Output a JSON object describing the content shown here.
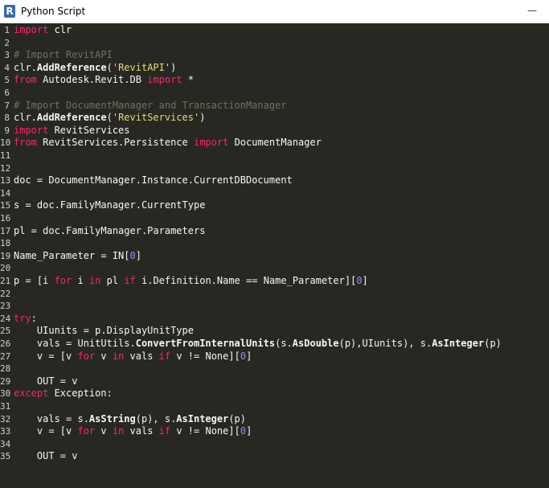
{
  "window": {
    "title": "Python Script",
    "app_icon_letter": "R",
    "minimize_glyph": "—"
  },
  "editor": {
    "lines": [
      {
        "n": "1",
        "tokens": [
          {
            "t": "import",
            "c": "kw"
          },
          {
            "t": " clr",
            "c": "id"
          }
        ]
      },
      {
        "n": "2",
        "tokens": []
      },
      {
        "n": "3",
        "tokens": [
          {
            "t": "# Import RevitAPI",
            "c": "com"
          }
        ]
      },
      {
        "n": "4",
        "tokens": [
          {
            "t": "clr.",
            "c": "id"
          },
          {
            "t": "AddReference",
            "c": "fn"
          },
          {
            "t": "(",
            "c": "id"
          },
          {
            "t": "'RevitAPI'",
            "c": "str"
          },
          {
            "t": ")",
            "c": "id"
          }
        ]
      },
      {
        "n": "5",
        "tokens": [
          {
            "t": "from",
            "c": "kw"
          },
          {
            "t": " Autodesk.Revit.DB ",
            "c": "id"
          },
          {
            "t": "import",
            "c": "kw"
          },
          {
            "t": " *",
            "c": "id"
          }
        ]
      },
      {
        "n": "6",
        "tokens": []
      },
      {
        "n": "7",
        "tokens": [
          {
            "t": "# Import DocumentManager and TransactionManager",
            "c": "com"
          }
        ]
      },
      {
        "n": "8",
        "tokens": [
          {
            "t": "clr.",
            "c": "id"
          },
          {
            "t": "AddReference",
            "c": "fn"
          },
          {
            "t": "(",
            "c": "id"
          },
          {
            "t": "'RevitServices'",
            "c": "str"
          },
          {
            "t": ")",
            "c": "id"
          }
        ]
      },
      {
        "n": "9",
        "tokens": [
          {
            "t": "import",
            "c": "kw"
          },
          {
            "t": " RevitServices",
            "c": "id"
          }
        ]
      },
      {
        "n": "10",
        "tokens": [
          {
            "t": "from",
            "c": "kw"
          },
          {
            "t": " RevitServices.Persistence ",
            "c": "id"
          },
          {
            "t": "import",
            "c": "kw"
          },
          {
            "t": " DocumentManager",
            "c": "id"
          }
        ]
      },
      {
        "n": "11",
        "tokens": []
      },
      {
        "n": "12",
        "tokens": []
      },
      {
        "n": "13",
        "tokens": [
          {
            "t": "doc = DocumentManager.Instance.CurrentDBDocument",
            "c": "id"
          }
        ]
      },
      {
        "n": "14",
        "tokens": []
      },
      {
        "n": "15",
        "tokens": [
          {
            "t": "s = doc.FamilyManager.CurrentType",
            "c": "id"
          }
        ]
      },
      {
        "n": "16",
        "tokens": []
      },
      {
        "n": "17",
        "tokens": [
          {
            "t": "pl = doc.FamilyManager.Parameters",
            "c": "id"
          }
        ]
      },
      {
        "n": "18",
        "tokens": []
      },
      {
        "n": "19",
        "tokens": [
          {
            "t": "Name_Parameter = IN[",
            "c": "id"
          },
          {
            "t": "0",
            "c": "num"
          },
          {
            "t": "]",
            "c": "id"
          }
        ]
      },
      {
        "n": "20",
        "tokens": []
      },
      {
        "n": "21",
        "tokens": [
          {
            "t": "p = [i ",
            "c": "id"
          },
          {
            "t": "for",
            "c": "kw"
          },
          {
            "t": " i ",
            "c": "id"
          },
          {
            "t": "in",
            "c": "kw"
          },
          {
            "t": " pl ",
            "c": "id"
          },
          {
            "t": "if",
            "c": "kw"
          },
          {
            "t": " i.Definition.Name == Name_Parameter][",
            "c": "id"
          },
          {
            "t": "0",
            "c": "num"
          },
          {
            "t": "]",
            "c": "id"
          }
        ]
      },
      {
        "n": "22",
        "tokens": []
      },
      {
        "n": "23",
        "tokens": []
      },
      {
        "n": "24",
        "tokens": [
          {
            "t": "try",
            "c": "kw"
          },
          {
            "t": ":",
            "c": "id"
          }
        ]
      },
      {
        "n": "25",
        "tokens": [
          {
            "t": "    UIunits = p.DisplayUnitType",
            "c": "id"
          }
        ]
      },
      {
        "n": "26",
        "tokens": [
          {
            "t": "    vals = UnitUtils.",
            "c": "id"
          },
          {
            "t": "ConvertFromInternalUnits",
            "c": "fn"
          },
          {
            "t": "(s.",
            "c": "id"
          },
          {
            "t": "AsDouble",
            "c": "fn"
          },
          {
            "t": "(p),UIunits), s.",
            "c": "id"
          },
          {
            "t": "AsInteger",
            "c": "fn"
          },
          {
            "t": "(p)",
            "c": "id"
          }
        ]
      },
      {
        "n": "27",
        "tokens": [
          {
            "t": "    v = [v ",
            "c": "id"
          },
          {
            "t": "for",
            "c": "kw"
          },
          {
            "t": " v ",
            "c": "id"
          },
          {
            "t": "in",
            "c": "kw"
          },
          {
            "t": " vals ",
            "c": "id"
          },
          {
            "t": "if",
            "c": "kw"
          },
          {
            "t": " v != None][",
            "c": "id"
          },
          {
            "t": "0",
            "c": "num"
          },
          {
            "t": "]",
            "c": "id"
          }
        ]
      },
      {
        "n": "28",
        "tokens": []
      },
      {
        "n": "29",
        "tokens": [
          {
            "t": "    OUT = v",
            "c": "id"
          }
        ]
      },
      {
        "n": "30",
        "tokens": [
          {
            "t": "except",
            "c": "kw"
          },
          {
            "t": " Exception:",
            "c": "id"
          }
        ]
      },
      {
        "n": "31",
        "tokens": []
      },
      {
        "n": "32",
        "tokens": [
          {
            "t": "    vals = s.",
            "c": "id"
          },
          {
            "t": "AsString",
            "c": "fn"
          },
          {
            "t": "(p), s.",
            "c": "id"
          },
          {
            "t": "AsInteger",
            "c": "fn"
          },
          {
            "t": "(p)",
            "c": "id"
          }
        ]
      },
      {
        "n": "33",
        "tokens": [
          {
            "t": "    v = [v ",
            "c": "id"
          },
          {
            "t": "for",
            "c": "kw"
          },
          {
            "t": " v ",
            "c": "id"
          },
          {
            "t": "in",
            "c": "kw"
          },
          {
            "t": " vals ",
            "c": "id"
          },
          {
            "t": "if",
            "c": "kw"
          },
          {
            "t": " v != None][",
            "c": "id"
          },
          {
            "t": "0",
            "c": "num"
          },
          {
            "t": "]",
            "c": "id"
          }
        ]
      },
      {
        "n": "34",
        "tokens": []
      },
      {
        "n": "35",
        "tokens": [
          {
            "t": "    OUT = v",
            "c": "id"
          }
        ]
      }
    ]
  }
}
